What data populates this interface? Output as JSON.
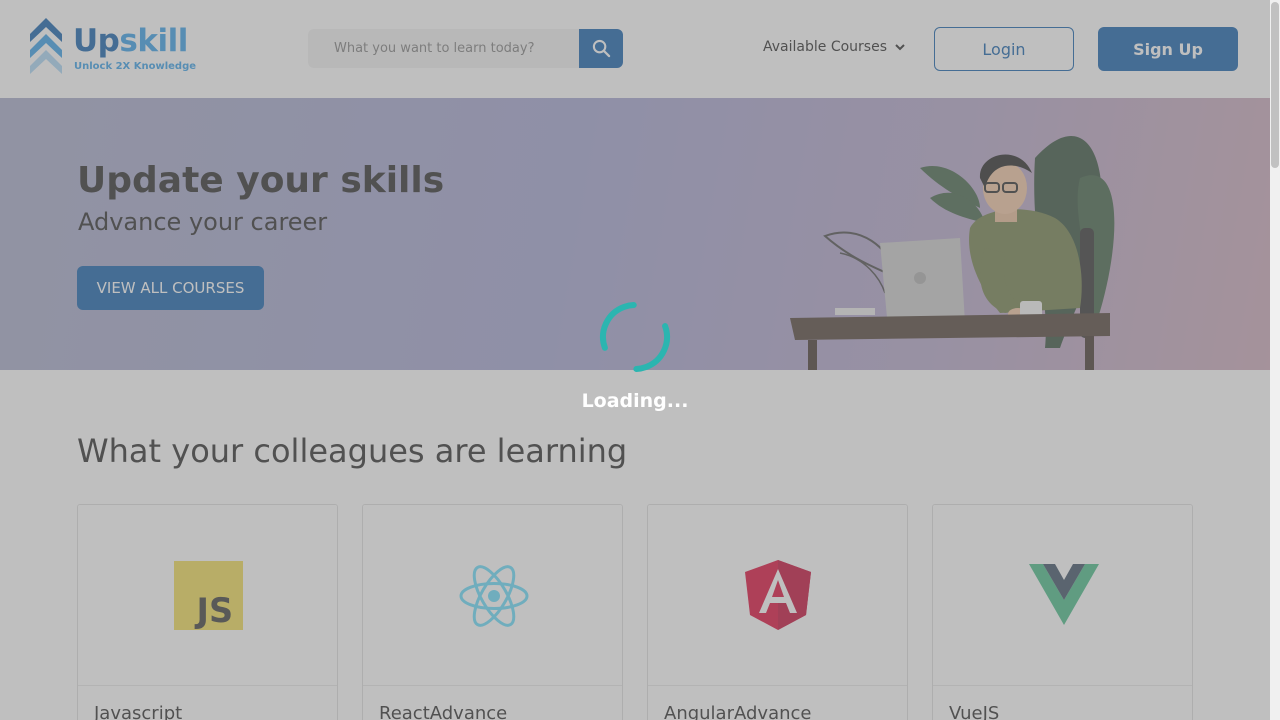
{
  "brand": {
    "name_part1": "Up",
    "name_part2": "skill",
    "tagline": "Unlock 2X Knowledge"
  },
  "search": {
    "placeholder": "What you want to learn today?",
    "icon": "search-icon"
  },
  "nav": {
    "courses_label": "Available Courses",
    "login_label": "Login",
    "signup_label": "Sign Up"
  },
  "hero": {
    "title": "Update your skills",
    "subtitle": "Advance your career",
    "cta_label": "VIEW ALL COURSES"
  },
  "section": {
    "title": "What your colleagues are learning"
  },
  "courses": [
    {
      "title": "Javascript",
      "icon": "javascript-logo-icon"
    },
    {
      "title": "ReactAdvance",
      "icon": "react-logo-icon"
    },
    {
      "title": "AngularAdvance",
      "icon": "angular-logo-icon"
    },
    {
      "title": "VueJS",
      "icon": "vue-logo-icon"
    }
  ],
  "overlay": {
    "loading_text": "Loading..."
  },
  "colors": {
    "primary": "#0a5aa8",
    "accent": "#2e9be6",
    "spinner": "#2bb5b0"
  }
}
